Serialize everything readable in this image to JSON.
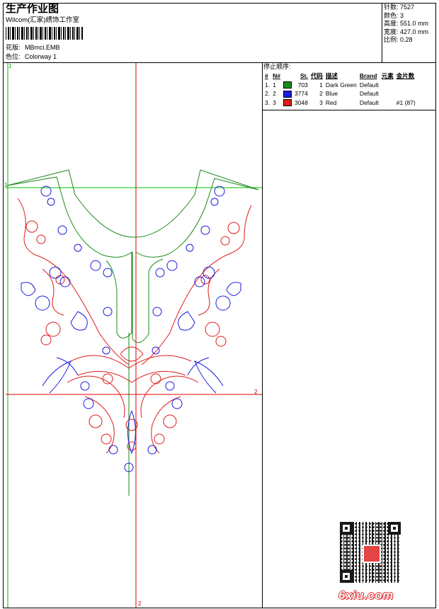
{
  "header": {
    "title": "生产作业图",
    "company": "Wilcom(汇家)绣饰工作室",
    "design_label": "花版:",
    "design_value": "MBmci.EMB",
    "colorway_label": "色位:",
    "colorway_value": "Colorway 1"
  },
  "stats": [
    {
      "label": "针数:",
      "value": "7527"
    },
    {
      "label": "颜色:",
      "value": "3"
    },
    {
      "label": "高度:",
      "value": "551.0 mm"
    },
    {
      "label": "宽度:",
      "value": "427.0 mm"
    },
    {
      "label": "比例:",
      "value": "0.28"
    }
  ],
  "stops": {
    "heading": "停止顺序:",
    "columns": [
      "#",
      "N#",
      "St.",
      "代码",
      "描述",
      "Brand",
      "元素",
      "金片数"
    ],
    "rows": [
      {
        "num": "1.",
        "n": "1",
        "swatch": "#1a8a1a",
        "st": "703",
        "code": "1",
        "desc": "Dark Green",
        "brand": "Default",
        "element": "",
        "sequins": ""
      },
      {
        "num": "2.",
        "n": "2",
        "swatch": "#1a1ae0",
        "st": "3774",
        "code": "2",
        "desc": "Blue",
        "brand": "Default",
        "element": "",
        "sequins": ""
      },
      {
        "num": "3.",
        "n": "3",
        "swatch": "#e01a1a",
        "st": "3048",
        "code": "3",
        "desc": "Red",
        "brand": "Default",
        "element": "",
        "sequins": "#1 (87)"
      }
    ]
  },
  "guides": {
    "marker_1": "1",
    "marker_2": "2"
  },
  "colors": {
    "green": "#1a8a1a",
    "blue": "#1a1ae0",
    "red": "#e01a1a",
    "guide_green": "#00c000",
    "guide_red": "#e00000"
  },
  "watermark": "6xiu.com",
  "qr_icon": "qr-code-icon"
}
